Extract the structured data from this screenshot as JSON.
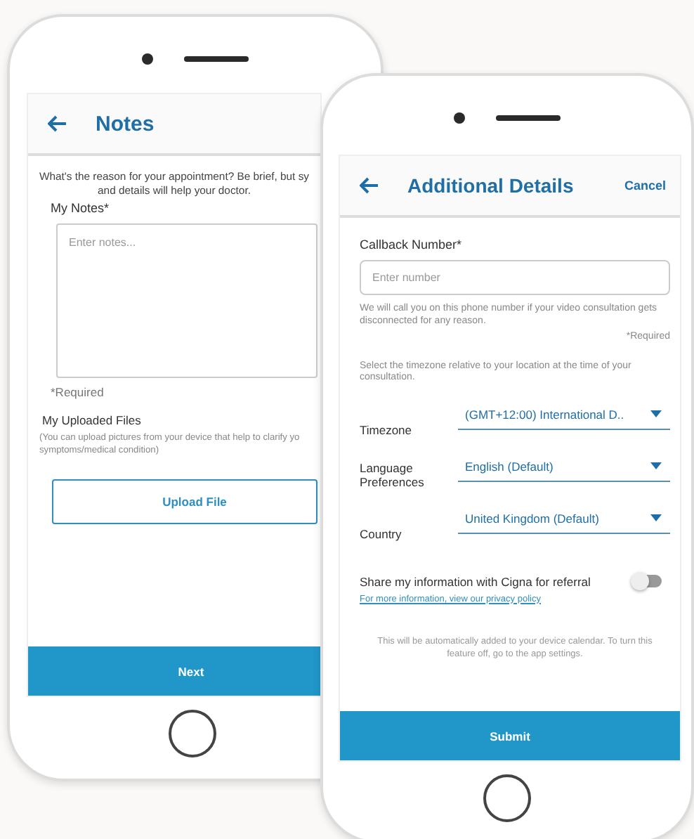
{
  "notes_screen": {
    "title": "Notes",
    "intro_lines": [
      "What's the reason for your appointment? Be brief, but sy",
      "and details will help your doctor."
    ],
    "notes_field": {
      "label": "My Notes*",
      "placeholder": "Enter notes..."
    },
    "required_note": "*Required",
    "uploaded_files": {
      "heading": "My Uploaded Files",
      "hint_lines": [
        "(You can upload pictures from your device that help to clarify yo",
        "symptoms/medical condition)"
      ]
    },
    "upload_button": "Upload File",
    "next_button": "Next"
  },
  "details_screen": {
    "title": "Additional Details",
    "cancel": "Cancel",
    "callback": {
      "label": "Callback Number*",
      "placeholder": "Enter number",
      "hint": "We will call you on this phone number if your video consultation gets disconnected for any reason.",
      "required_note": "*Required"
    },
    "timezone_hint": "Select the timezone relative to your location at the time of your consultation.",
    "dropdowns": [
      {
        "label": "Timezone",
        "value": "(GMT+12:00) International D.."
      },
      {
        "label": "Language Preferences",
        "value": "English (Default)"
      },
      {
        "label": "Country",
        "value": "United Kingdom  (Default)"
      }
    ],
    "share": {
      "label": "Share my information with Cigna for referral",
      "on": false,
      "link": "For more information, view our privacy policy"
    },
    "calendar_note": "This will be automatically added to your device calendar. To turn this feature off, go to the app settings.",
    "submit_button": "Submit"
  }
}
